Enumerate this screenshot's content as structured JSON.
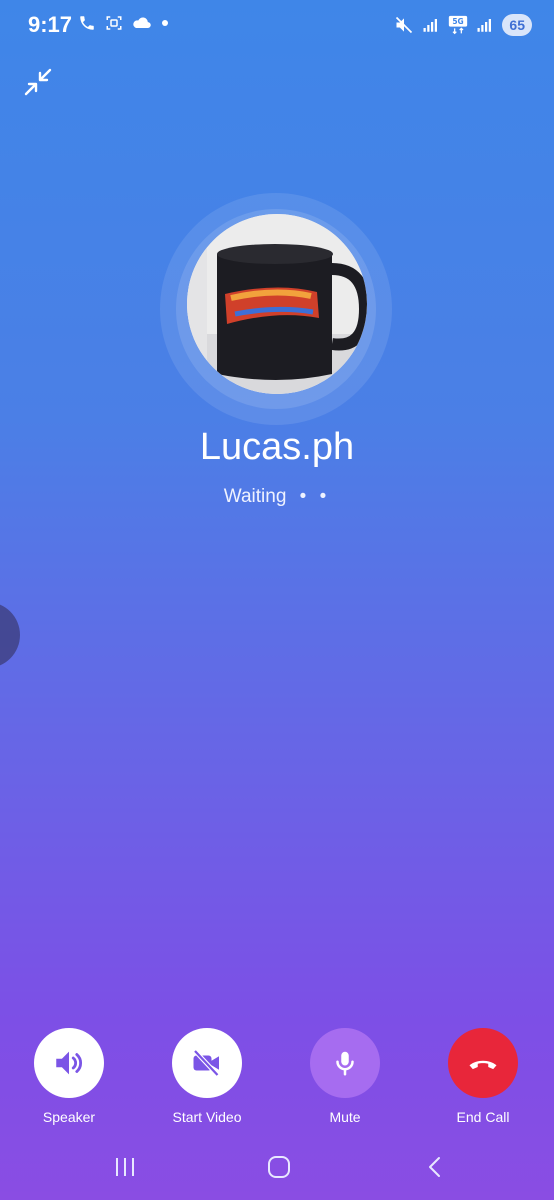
{
  "status_bar": {
    "time": "9:17",
    "battery": "65"
  },
  "contact": {
    "name": "Lucas.ph",
    "status": "Waiting",
    "status_dots": "• •"
  },
  "controls": [
    {
      "label": "Speaker",
      "icon": "speaker-icon"
    },
    {
      "label": "Start Video",
      "icon": "video-off-icon"
    },
    {
      "label": "Mute",
      "icon": "microphone-icon"
    },
    {
      "label": "End Call",
      "icon": "end-call-icon"
    }
  ],
  "colors": {
    "end_call": "#e8263a",
    "mute_bg": "#a66cf0",
    "button_bg": "#ffffff",
    "button_icon": "#7b55e6"
  }
}
